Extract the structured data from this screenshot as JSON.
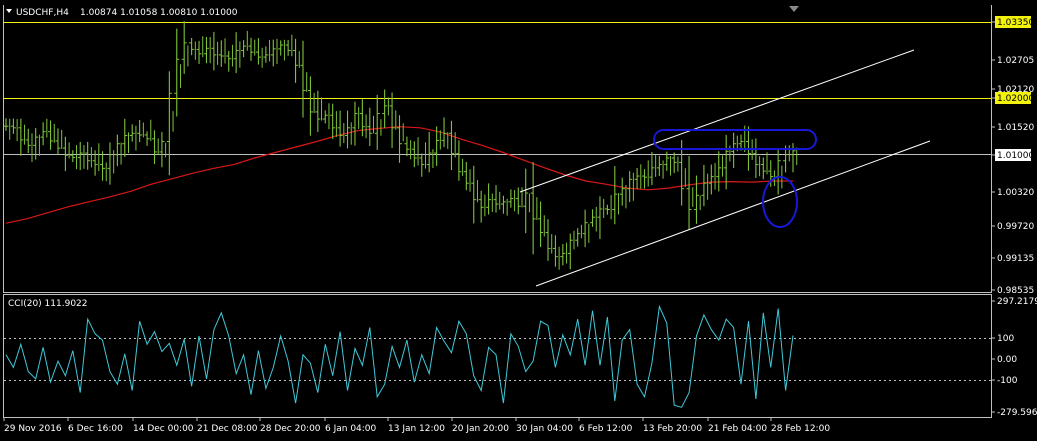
{
  "header": {
    "symbol": "USDCHF,H4",
    "ohlc": "1.00874 1.01058 1.00810 1.01000"
  },
  "indicator": {
    "label": "CCI(20) 111.9022"
  },
  "colors": {
    "background": "#000000",
    "grid": "#c0c0c0",
    "candles": "#7fc33a",
    "ma": "#d81818",
    "cci": "#40c8d8",
    "hline": "#f2f20a",
    "highlight": "#1818d8",
    "channel": "#ffffff"
  },
  "chart_data": [
    {
      "type": "candlestick",
      "instrument": "USDCHF",
      "timeframe": "H4",
      "current": {
        "open": 1.00874,
        "high": 1.01058,
        "low": 1.0081,
        "close": 1.01
      },
      "price_ticks": [
        "1.03350",
        "1.02705",
        "1.02120",
        "1.02000",
        "1.01520",
        "1.01000",
        "1.00320",
        "0.99720",
        "0.99135",
        "0.98535"
      ],
      "highlighted_ticks": [
        "1.03350",
        "1.02000"
      ],
      "ylim": [
        0.98535,
        1.0335
      ],
      "horizontal_levels": [
        1.0335,
        1.02,
        1.01
      ],
      "time_labels": [
        "29 Nov 2016",
        "6 Dec 16:00",
        "14 Dec 00:00",
        "21 Dec 08:00",
        "28 Dec 20:00",
        "6 Jan 04:00",
        "13 Jan 12:00",
        "20 Jan 20:00",
        "30 Jan 04:00",
        "6 Feb 12:00",
        "13 Feb 20:00",
        "21 Feb 04:00",
        "28 Feb 12:00"
      ],
      "close_path": [
        1.0145,
        1.0142,
        1.012,
        1.011,
        1.0125,
        1.0135,
        1.0118,
        1.0105,
        1.0092,
        1.0088,
        1.0096,
        1.0082,
        1.0075,
        1.0068,
        1.0093,
        1.0113,
        1.0128,
        1.0132,
        1.0129,
        1.0122,
        1.0098,
        1.0117,
        1.0205,
        1.0267,
        1.0297,
        1.0285,
        1.0277,
        1.0287,
        1.0275,
        1.0273,
        1.0268,
        1.0283,
        1.0291,
        1.028,
        1.0271,
        1.0275,
        1.0286,
        1.0293,
        1.0283,
        1.0256,
        1.021,
        1.0171,
        1.0158,
        1.0165,
        1.0142,
        1.0128,
        1.0142,
        1.0168,
        1.0144,
        1.0132,
        1.0168,
        1.0182,
        1.0142,
        1.0113,
        1.0103,
        1.0087,
        1.0075,
        1.0096,
        1.0119,
        1.0132,
        1.0095,
        1.0062,
        1.0041,
        1.0011,
        0.9997,
        1.0011,
        1.0003,
        1.0007,
        1.0013,
        0.9999,
        1.0023,
        0.9976,
        0.9951,
        0.9922,
        0.9907,
        0.9913,
        0.9937,
        0.9949,
        0.9969,
        0.9979,
        0.9994,
        0.9993,
        1.0021,
        1.0031,
        1.0048,
        1.0054,
        1.0052,
        1.0069,
        1.0075,
        1.0087,
        1.0079,
        1.0031,
        0.9993,
        1.0019,
        1.0041,
        1.0053,
        1.0069,
        1.0099,
        1.0113,
        1.0117,
        1.0095,
        1.0075,
        1.0063,
        1.0053,
        1.0082,
        1.0093,
        1.01
      ],
      "series": [
        {
          "name": "CCI(20)",
          "type": "line",
          "panel": "lower",
          "value_now": 111.9022,
          "ticks": [
            "297.2179",
            "100",
            "0.00",
            "-100",
            "-279.5963"
          ],
          "levels": [
            100,
            -100
          ],
          "ylim": [
            -279.5963,
            297.2179
          ],
          "values": [
            20,
            -40,
            70,
            -60,
            -95,
            55,
            -110,
            -10,
            -80,
            40,
            -160,
            190,
            120,
            90,
            -60,
            -120,
            25,
            -150,
            180,
            70,
            130,
            35,
            75,
            -30,
            95,
            -130,
            110,
            -95,
            140,
            220,
            110,
            -70,
            20,
            -170,
            40,
            -140,
            -40,
            110,
            -10,
            -210,
            20,
            -20,
            -160,
            70,
            -80,
            130,
            -150,
            50,
            -30,
            150,
            -180,
            -120,
            60,
            -40,
            90,
            -110,
            20,
            -70,
            150,
            85,
            30,
            180,
            120,
            -80,
            -150,
            55,
            20,
            -210,
            120,
            60,
            -60,
            -10,
            180,
            160,
            -40,
            115,
            20,
            190,
            -30,
            230,
            -30,
            200,
            -200,
            90,
            140,
            -120,
            -180,
            -20,
            250,
            170,
            -220,
            -230,
            -160,
            110,
            210,
            140,
            90,
            190,
            150,
            -120,
            180,
            -190,
            220,
            -40,
            240,
            -150,
            112
          ]
        },
        {
          "name": "moving-average",
          "type": "line",
          "panel": "upper",
          "values": [
            0.9968,
            0.9976,
            0.9987,
            0.9998,
            1.0007,
            1.0016,
            1.0026,
            1.0039,
            1.0049,
            1.0059,
            1.0068,
            1.0075,
            1.0087,
            1.0097,
            1.0107,
            1.0117,
            1.0128,
            1.0137,
            1.0141,
            1.0144,
            1.0142,
            1.0134,
            1.0121,
            1.011,
            1.0097,
            1.0083,
            1.0069,
            1.0056,
            1.0045,
            1.0039,
            1.0032,
            1.0029,
            1.0032,
            1.0038,
            1.0043,
            1.0044,
            1.0043,
            1.0045,
            1.0045
          ]
        }
      ],
      "annotations": [
        {
          "type": "channel-line",
          "from": {
            "time": "30 Jan 04:00",
            "price": 1.0039
          },
          "to": {
            "time": "1 Mar",
            "price": 1.0281
          }
        },
        {
          "type": "channel-line",
          "from": {
            "time": "30 Jan 04:00",
            "price": 0.9862
          },
          "to": {
            "time": "1 Mar",
            "price": 1.0128
          }
        },
        {
          "type": "ellipse",
          "around": "1.01000 resistance, 13 Feb - 28 Feb"
        },
        {
          "type": "ellipse",
          "around": "channel support touch, 28 Feb"
        }
      ]
    }
  ]
}
